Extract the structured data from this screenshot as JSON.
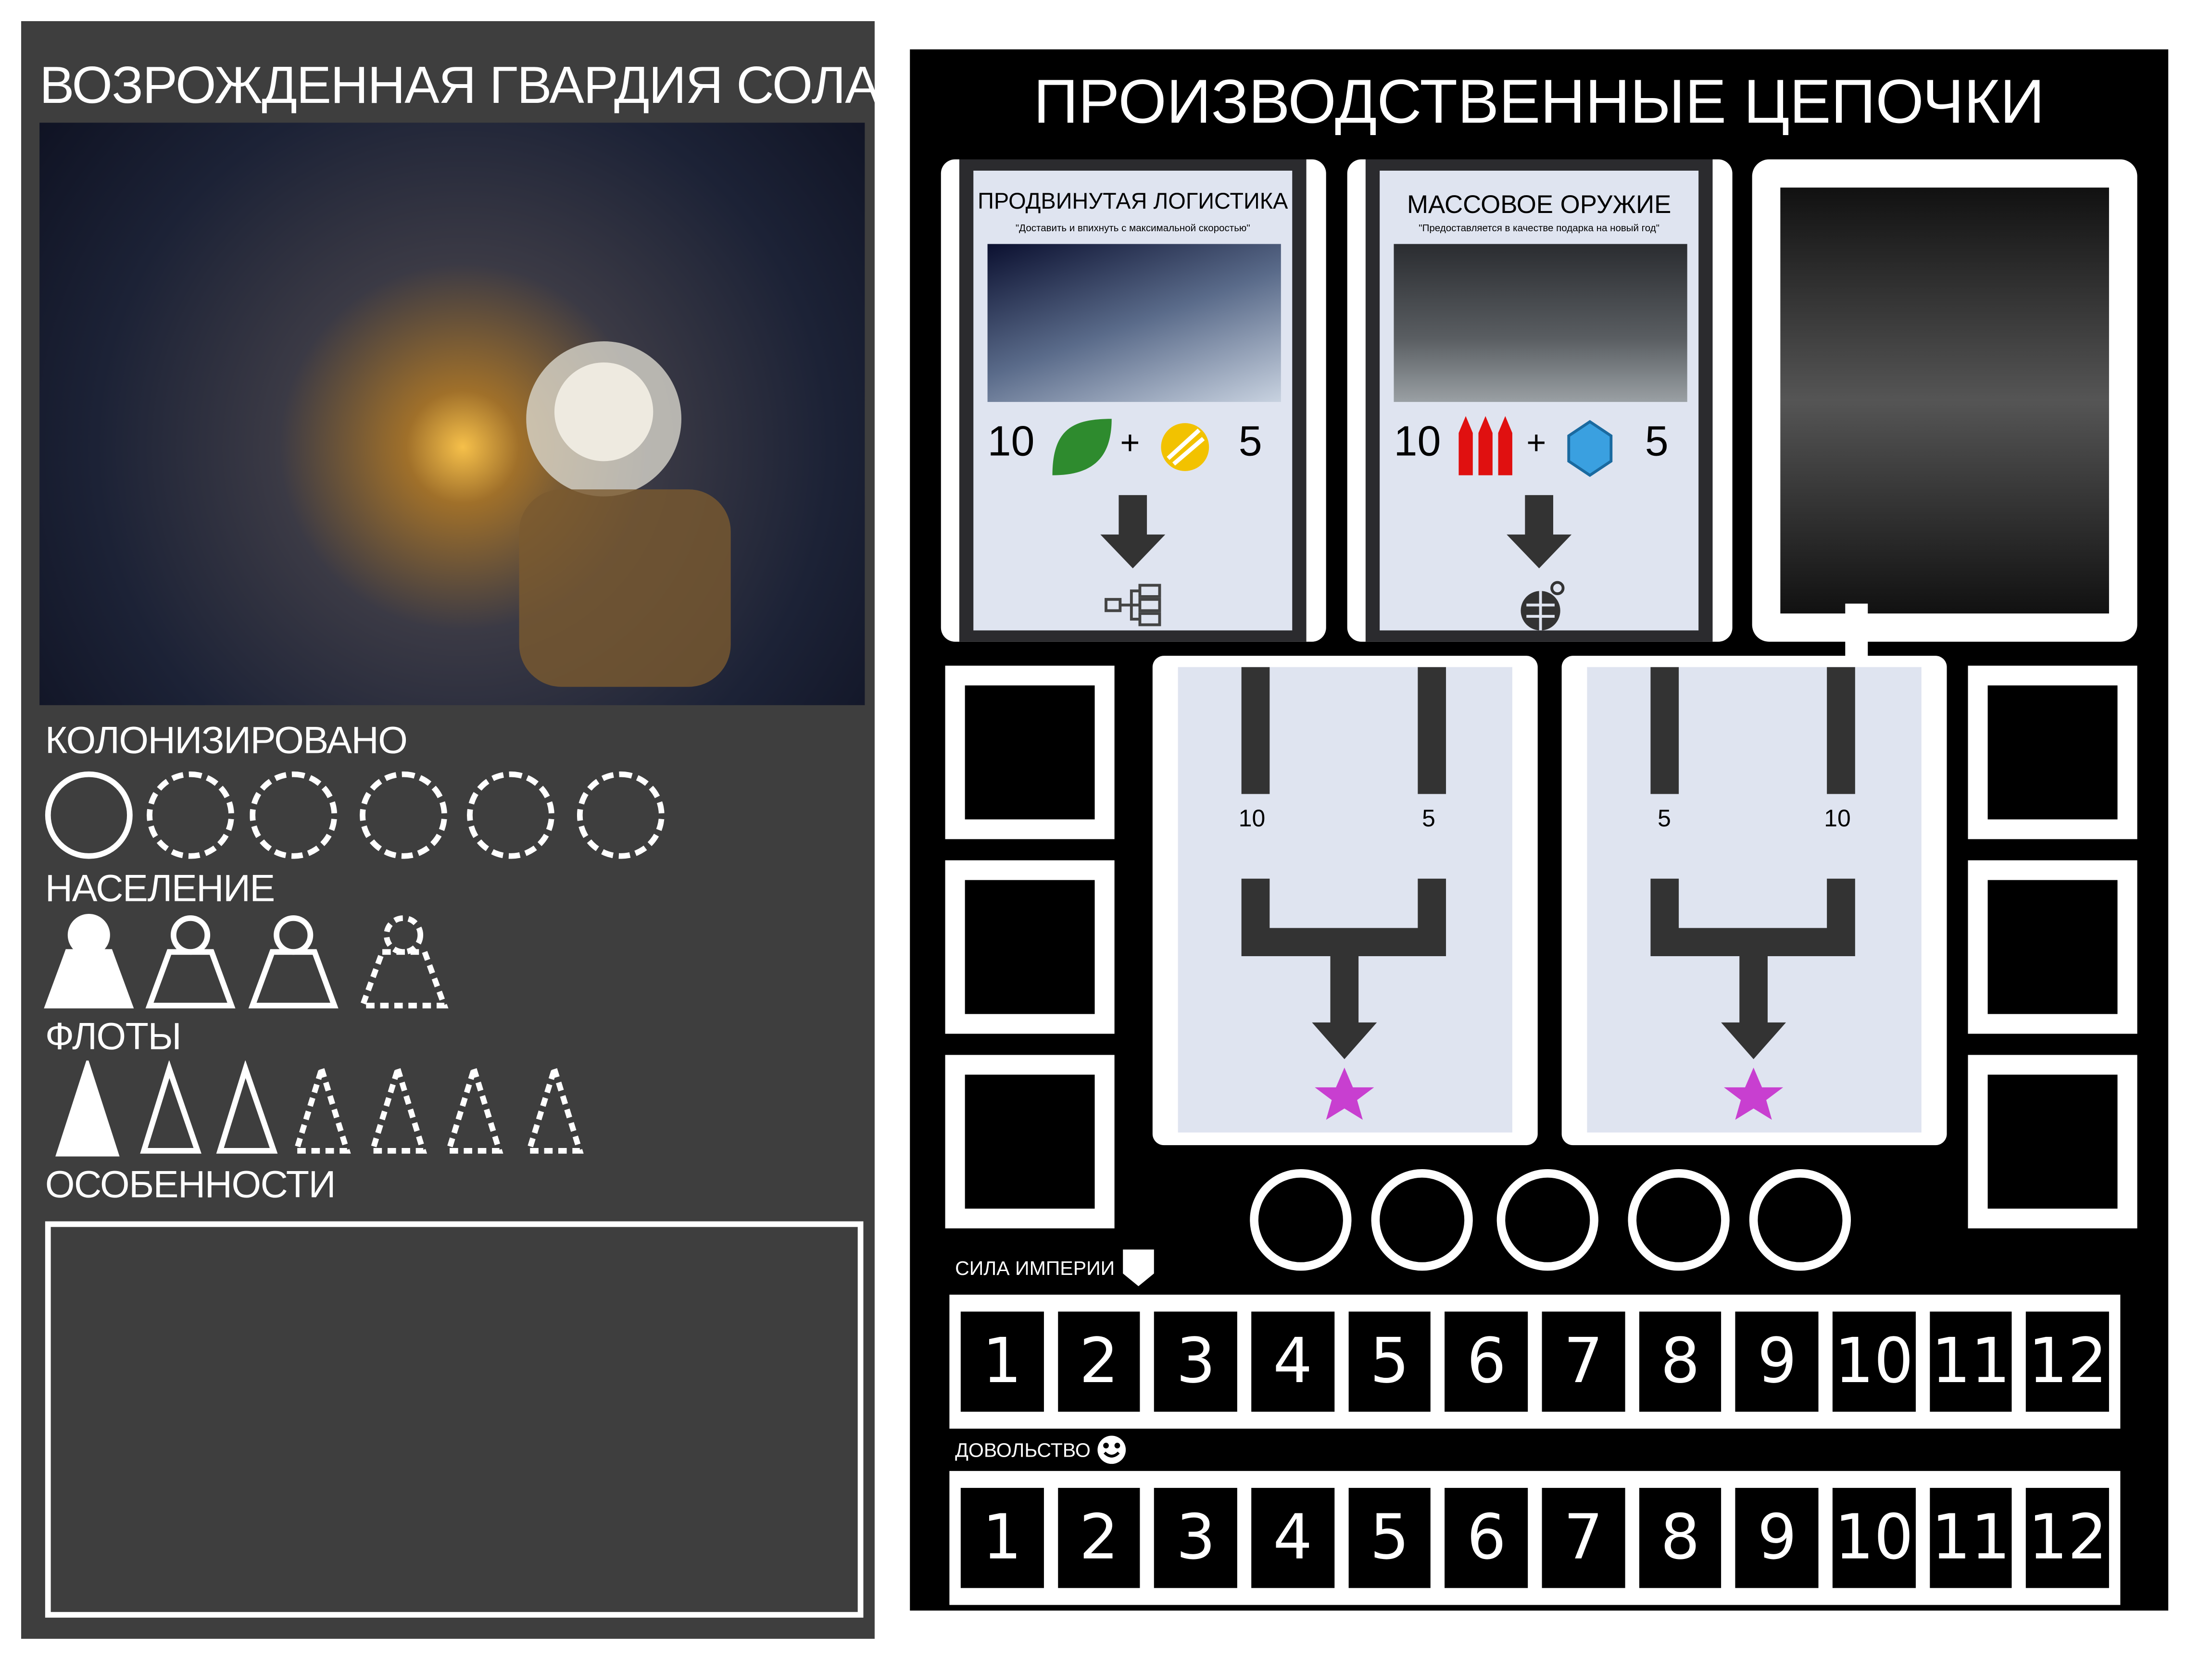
{
  "left": {
    "title": "ВОЗРОЖДЕННАЯ ГВАРДИЯ СОЛА",
    "colonized_label": "КОЛОНИЗИРОВАНО",
    "colonized": {
      "filled": 1,
      "total": 6
    },
    "population_label": "НАСЕЛЕНИЕ",
    "population": {
      "filled": 1,
      "solid_outline": 2,
      "dashed": 1
    },
    "fleets_label": "ФЛОТЫ",
    "fleets": {
      "filled": 1,
      "solid_outline": 2,
      "dashed": 4
    },
    "features_label": "ОСОБЕННОСТИ"
  },
  "right": {
    "title": "ПРОИЗВОДСТВЕННЫЕ ЦЕПОЧКИ",
    "cards": [
      {
        "title": "ПРОДВИНУТАЯ ЛОГИСТИКА",
        "quote": "\"Доставить и впихнуть с максимальной скоростью\"",
        "cost_a": "10",
        "plus": "+",
        "cost_b": "5",
        "res_a": "leaf-icon",
        "res_b": "coin-icon",
        "output": "network-icon"
      },
      {
        "title": "МАССОВОЕ ОРУЖИЕ",
        "quote": "\"Предоставляется в качестве подарка на новый год\"",
        "cost_a": "10",
        "plus": "+",
        "cost_b": "5",
        "res_a": "ammo-icon",
        "res_b": "crystal-icon",
        "output": "grenade-icon"
      }
    ],
    "chains": [
      {
        "left": "10",
        "right": "5"
      },
      {
        "left": "5",
        "right": "10"
      }
    ],
    "empire_label": "СИЛА ИМПЕРИИ",
    "happiness_label": "ДОВОЛЬСТВО",
    "track": [
      "1",
      "2",
      "3",
      "4",
      "5",
      "6",
      "7",
      "8",
      "9",
      "10",
      "11",
      "12"
    ],
    "colors": {
      "star": "#c83fd0",
      "leaf": "#2e8b2e",
      "ammo": "#e01010",
      "crystal": "#3aa0e0",
      "coin": "#f2c200"
    }
  }
}
